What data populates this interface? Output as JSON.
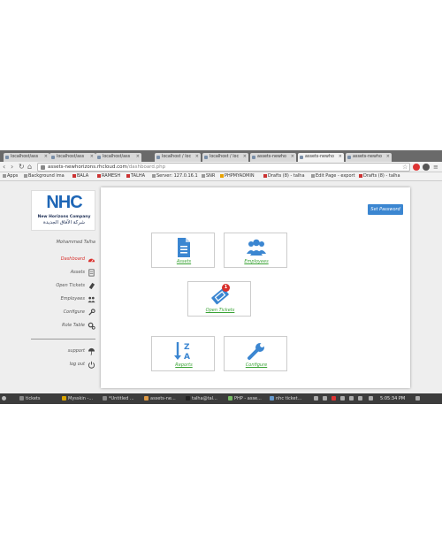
{
  "browser": {
    "tabs": [
      "localhost/ass",
      "localhost/ass",
      "localhost/ass",
      "localhost / loc",
      "localhost / loc",
      "assets-newho",
      "assets-newho",
      "assets-newho"
    ],
    "url_domain": "assets-newhorizons.rhcloud.com",
    "url_path": "/dashboard.php",
    "bookmarks": [
      "Apps",
      "Background ima",
      "BALA",
      "RAMESH",
      "TALHA",
      "Server: 127.0.16.1",
      "SNR",
      "PHPMYADMIN",
      "Drafts (8) - talha",
      "Edit Page - export",
      "Drafts (8) - talha"
    ]
  },
  "logo": {
    "mark": "NHC",
    "company": "New Horizons Company",
    "arabic": "شركة الآفاق الجديدة"
  },
  "user": {
    "name": "Mohammed Talha"
  },
  "sidebar": {
    "items": [
      {
        "label": "Dashboard",
        "icon": "dashboard-icon",
        "active": true
      },
      {
        "label": "Assets",
        "icon": "document-icon",
        "active": false
      },
      {
        "label": "Open Tickets",
        "icon": "ticket-icon",
        "active": false
      },
      {
        "label": "Employees",
        "icon": "users-icon",
        "active": false
      },
      {
        "label": "Configure",
        "icon": "wrench-icon",
        "active": false
      },
      {
        "label": "Role Table",
        "icon": "cogs-icon",
        "active": false
      }
    ],
    "bottom": [
      {
        "label": "support",
        "icon": "umbrella-icon"
      },
      {
        "label": "log out",
        "icon": "power-icon"
      }
    ]
  },
  "main": {
    "set_password": "Set Password",
    "cards": [
      {
        "label": "Assets",
        "icon": "document-icon"
      },
      {
        "label": "Employees",
        "icon": "users-icon"
      },
      {
        "label": "Open Tickets",
        "icon": "ticket-icon",
        "badge": "1"
      },
      {
        "label": "Reports",
        "icon": "sort-za-icon"
      },
      {
        "label": "Configure",
        "icon": "wrench-icon"
      }
    ]
  },
  "taskbar": {
    "items": [
      "tickets",
      "Mysskin -...",
      "*Untitled ...",
      "assets-ne...",
      "talha@tal...",
      "PHP - asse...",
      "nhc ticket..."
    ],
    "clock": "5:05:34 PM"
  },
  "colors": {
    "brand_blue": "#3b86d1",
    "accent_green": "#3aa335",
    "active_red": "#d9302c"
  }
}
